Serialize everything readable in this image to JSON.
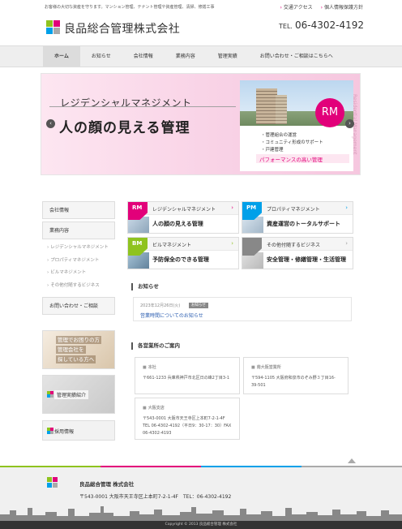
{
  "colors": {
    "magenta": "#e2007a",
    "cyan": "#00a0e9",
    "green": "#8fc31f",
    "gray": "#888888"
  },
  "header": {
    "tagline": "お客様の大切な資産を守ります。マンション管理、テナント管理や資産管理、清掃、修繕工事",
    "links": [
      "交通アクセス",
      "個人情報保護方針"
    ],
    "company": "良品総合管理株式会社",
    "tel_label": "TEL.",
    "tel_number": "06-4302-4192"
  },
  "nav": [
    "ホーム",
    "お知らせ",
    "会社情報",
    "業務内容",
    "管理実績",
    "お問い合わせ・ご相談はこちらへ"
  ],
  "hero": {
    "subtitle": "レジデンシャルマネジメント",
    "title": "人の顔の見える管理",
    "badge": "RM",
    "bullets": [
      "・管理組合の運営",
      "・コミュニティ形成のサポート",
      "・戸建管理"
    ],
    "performance": "パフォーマンスの高い管理",
    "vertical": "Residential Management"
  },
  "sidebar": {
    "company": "会社情報",
    "business": "業務内容",
    "subs": [
      "レジデンシャルマネジメント",
      "プロパティマネジメント",
      "ビルマネジメント",
      "その他付随するビジネス"
    ],
    "contact": "お問い合わせ・ご相談",
    "banner1": [
      "管理でお困りの方",
      "管理会社を",
      "探している方へ"
    ],
    "banner2": "管理実績紹介",
    "banner3": "採用情報"
  },
  "tiles": [
    {
      "code": "RM",
      "title": "レジデンシャルマネジメント",
      "main": "人の顔の見える管理"
    },
    {
      "code": "PM",
      "title": "プロパティマネジメント",
      "main": "資産運営のトータルサポート"
    },
    {
      "code": "BM",
      "title": "ビルマネジメント",
      "main": "予防保全のできる管理"
    },
    {
      "code": "",
      "title": "その他付随するビジネス",
      "main": "安全管理・修繕管理・生活管理"
    }
  ],
  "news": {
    "heading": "お知らせ",
    "date": "2023年12月26日(火)",
    "tag": "お知らせ",
    "link": "営業時間についてのお知らせ"
  },
  "offices": {
    "heading": "各営業所のご案内",
    "list": [
      {
        "name": "本社",
        "address": "〒661-1233 兵庫県神戸市北区日の峰2丁目3-1"
      },
      {
        "name": "南大阪営業所",
        "address": "〒594-1105 大阪府和泉市のぞみ野３丁目16-39-501"
      },
      {
        "name": "大阪支店",
        "address": "〒543-0001 大阪市天王寺区上本町7-2-1-4F TEL 06-4302-4192（平日9：30-17：30）FAX 06-4302-4193"
      }
    ]
  },
  "footer": {
    "company": "良品総合管理 株式会社",
    "address": "〒543-0001 大阪市天王寺区上本町7-2-1-4F　TEL：06-4302-4192",
    "copyright": "Copyright © 2013 良品総合管理 株式会社"
  }
}
